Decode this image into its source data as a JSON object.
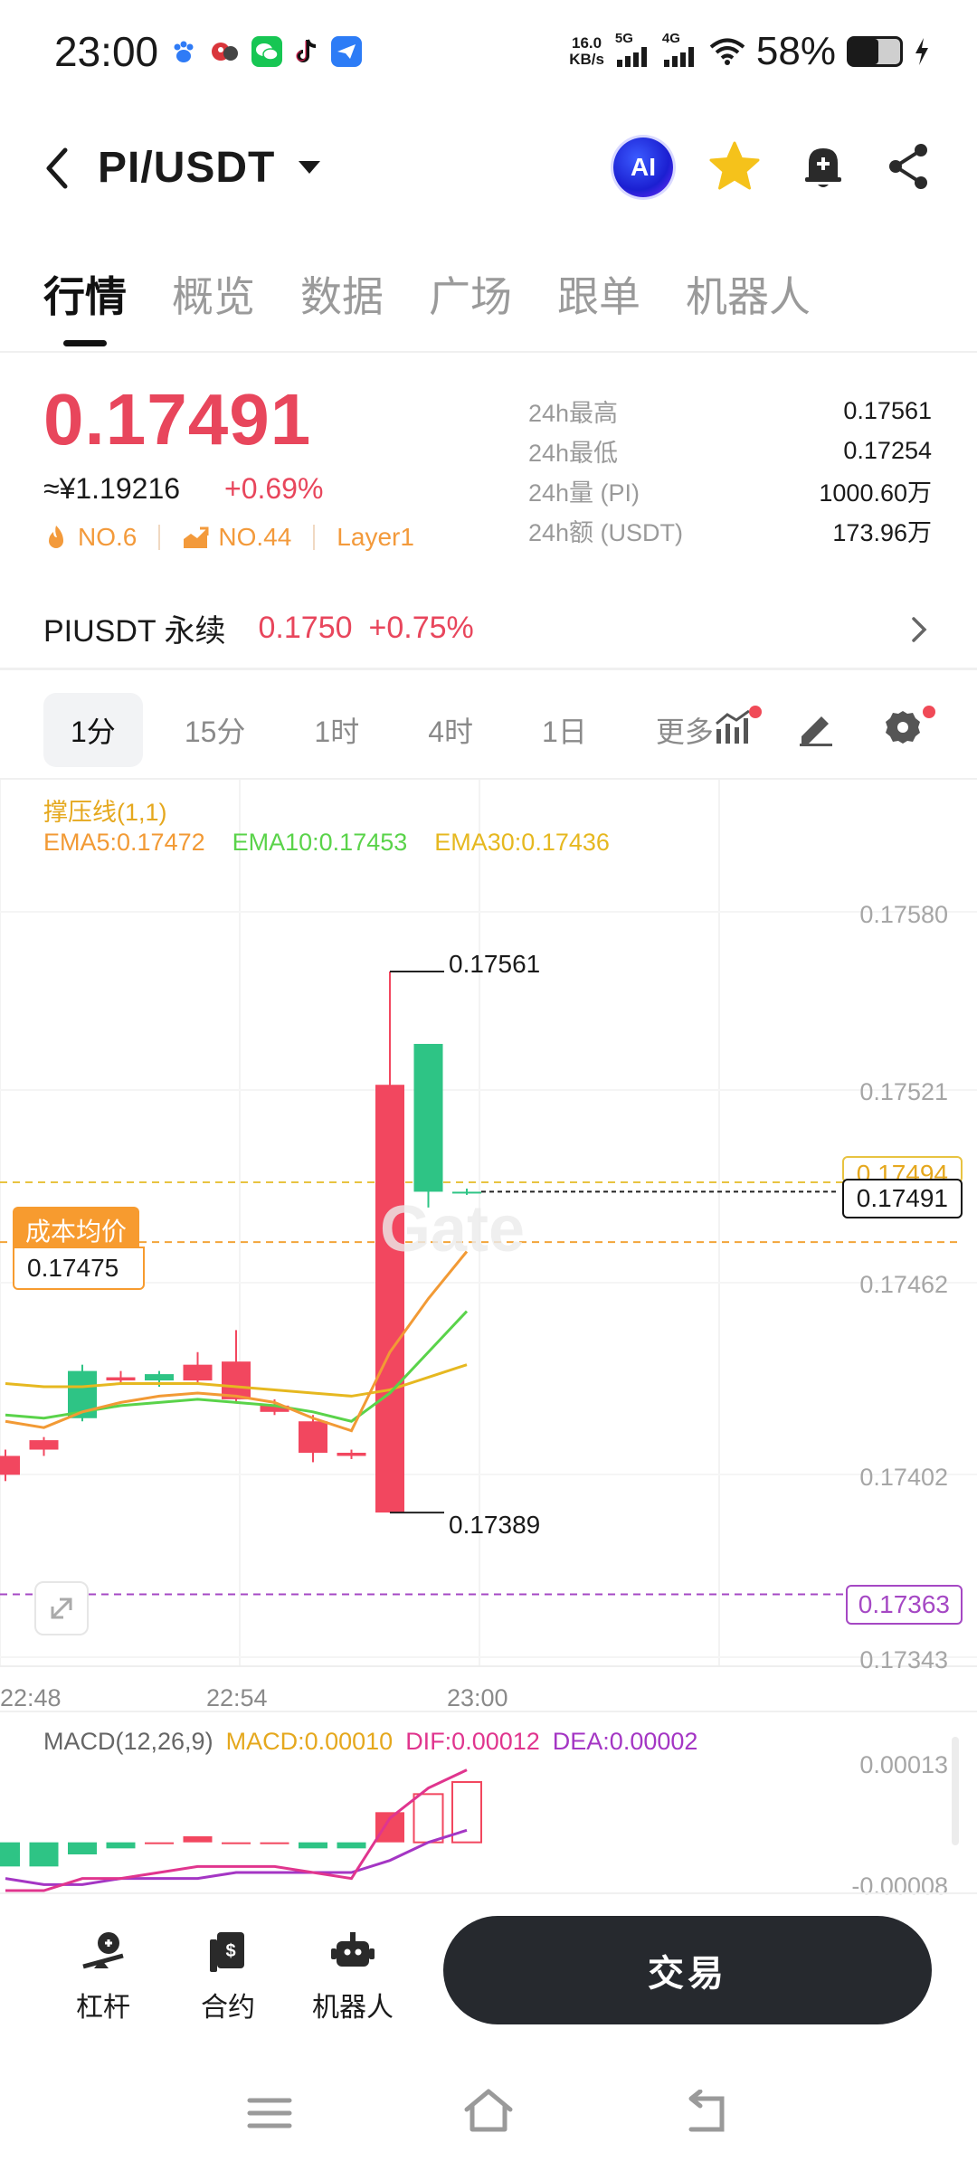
{
  "status_bar": {
    "time": "23:00",
    "net_speed_value": "16.0",
    "net_speed_unit": "KB/s",
    "network_1": "5G",
    "network_2": "4G",
    "battery_text": "58%",
    "battery_level": 0.58
  },
  "header": {
    "pair": "PI/USDT",
    "ai_label": "AI"
  },
  "tabs": [
    {
      "label": "行情"
    },
    {
      "label": "概览"
    },
    {
      "label": "数据"
    },
    {
      "label": "广场"
    },
    {
      "label": "跟单"
    },
    {
      "label": "机器人"
    }
  ],
  "price": {
    "last": "0.17491",
    "cny": "≈¥1.19216",
    "change": "+0.69%",
    "rank1": "NO.6",
    "rank2": "NO.44",
    "category": "Layer1",
    "stats": [
      {
        "label": "24h最高",
        "value": "0.17561"
      },
      {
        "label": "24h最低",
        "value": "0.17254"
      },
      {
        "label": "24h量 (PI)",
        "value": "1000.60万"
      },
      {
        "label": "24h额 (USDT)",
        "value": "173.96万"
      }
    ]
  },
  "perpetual": {
    "name": "PIUSDT 永续",
    "price": "0.1750",
    "change": "+0.75%"
  },
  "timeframes": [
    {
      "label": "1分"
    },
    {
      "label": "15分"
    },
    {
      "label": "1时"
    },
    {
      "label": "4时"
    },
    {
      "label": "1日"
    },
    {
      "label": "更多"
    }
  ],
  "chart": {
    "indicator_title": "撑压线(1,1)",
    "ema5": "EMA5:0.17472",
    "ema10": "EMA10:0.17453",
    "ema30": "EMA30:0.17436",
    "high_label": "0.17561",
    "low_label": "0.17389",
    "cost_label": "成本均价",
    "cost_value": "0.17475",
    "last_price_tag": "0.17491",
    "hidden_tag": "0.17494",
    "liq_tag": "0.17363",
    "watermark": "Gate",
    "macd_title": "MACD(12,26,9)",
    "macd": "MACD:0.00010",
    "dif": "DIF:0.00012",
    "dea": "DEA:0.00002",
    "macd_top": "0.00013",
    "macd_bottom": "-0.00008",
    "colors": {
      "up": "#2ec485",
      "down": "#f2475f",
      "ema5": "#f29a35",
      "ema10": "#5ad34a",
      "ema30": "#e6b820",
      "dif": "#e0358e",
      "dea": "#a436c4"
    }
  },
  "chart_data": {
    "type": "candlestick",
    "y_ticks": [
      "0.17580",
      "0.17521",
      "0.17462",
      "0.17402",
      "0.17343"
    ],
    "x_ticks": [
      "22:48",
      "22:54",
      "23:00"
    ],
    "ylim": [
      0.17333,
      0.176
    ],
    "candles": [
      {
        "o": 0.17407,
        "c": 0.17401,
        "h": 0.17409,
        "l": 0.17399
      },
      {
        "o": 0.17412,
        "c": 0.17409,
        "h": 0.17413,
        "l": 0.17407
      },
      {
        "o": 0.17419,
        "c": 0.17434,
        "h": 0.17436,
        "l": 0.17418
      },
      {
        "o": 0.17432,
        "c": 0.17431,
        "h": 0.17434,
        "l": 0.1743
      },
      {
        "o": 0.17431,
        "c": 0.17433,
        "h": 0.17434,
        "l": 0.17429
      },
      {
        "o": 0.17436,
        "c": 0.17431,
        "h": 0.1744,
        "l": 0.1743
      },
      {
        "o": 0.17437,
        "c": 0.17425,
        "h": 0.17447,
        "l": 0.17424
      },
      {
        "o": 0.17423,
        "c": 0.17421,
        "h": 0.17425,
        "l": 0.1742
      },
      {
        "o": 0.17418,
        "c": 0.17408,
        "h": 0.1742,
        "l": 0.17405
      },
      {
        "o": 0.17408,
        "c": 0.17407,
        "h": 0.17409,
        "l": 0.17406
      },
      {
        "o": 0.17525,
        "c": 0.17389,
        "h": 0.17561,
        "l": 0.17389
      },
      {
        "o": 0.17491,
        "c": 0.17538,
        "h": 0.17538,
        "l": 0.17486
      },
      {
        "o": 0.17491,
        "c": 0.17491,
        "h": 0.17492,
        "l": 0.1749
      }
    ],
    "ema5": [
      0.17418,
      0.17416,
      0.17421,
      0.17424,
      0.17426,
      0.17427,
      0.17426,
      0.17424,
      0.17419,
      0.17415,
      0.1744,
      0.17457,
      0.17472
    ],
    "ema10": [
      0.1742,
      0.17419,
      0.17421,
      0.17423,
      0.17424,
      0.17425,
      0.17424,
      0.17423,
      0.17421,
      0.17418,
      0.17427,
      0.1744,
      0.17453
    ],
    "ema30": [
      0.1743,
      0.17429,
      0.17429,
      0.1743,
      0.1743,
      0.1743,
      0.17429,
      0.17428,
      0.17427,
      0.17426,
      0.17428,
      0.17432,
      0.17436
    ],
    "macd_hist": [
      -4e-05,
      -4e-05,
      -2e-05,
      -1e-05,
      0.0,
      1e-05,
      0.0,
      0.0,
      -1e-05,
      -1e-05,
      5e-05,
      8e-05,
      0.0001
    ],
    "dif": [
      -8e-05,
      -8e-05,
      -6e-05,
      -6e-05,
      -5e-05,
      -4e-05,
      -4e-05,
      -4e-05,
      -5e-05,
      -6e-05,
      4e-05,
      9e-05,
      0.00012
    ],
    "dea": [
      -6e-05,
      -7e-05,
      -7e-05,
      -6e-05,
      -6e-05,
      -6e-05,
      -5e-05,
      -5e-05,
      -5e-05,
      -5e-05,
      -3e-05,
      0.0,
      2e-05
    ],
    "macd_ylim": [
      -9e-05,
      0.00014
    ]
  },
  "bottom": {
    "items": [
      {
        "label": "杠杆"
      },
      {
        "label": "合约"
      },
      {
        "label": "机器人"
      }
    ],
    "trade_label": "交易"
  }
}
